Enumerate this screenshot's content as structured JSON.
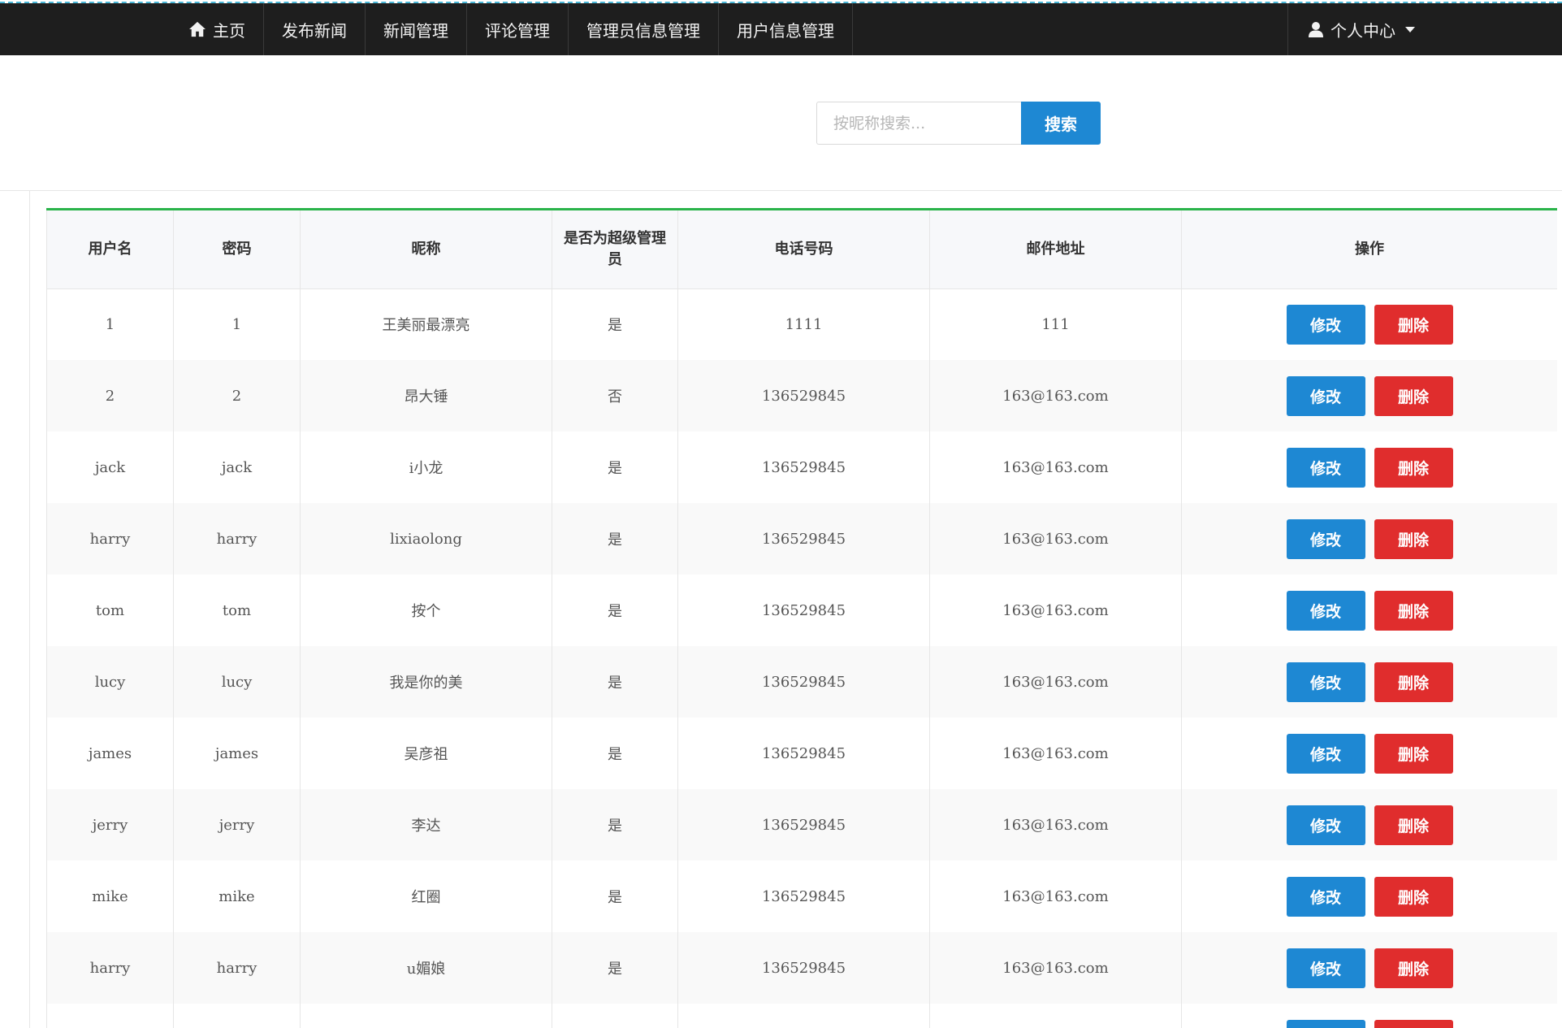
{
  "nav": {
    "items": [
      {
        "label": "主页",
        "icon": "home-icon"
      },
      {
        "label": "发布新闻"
      },
      {
        "label": "新闻管理"
      },
      {
        "label": "评论管理"
      },
      {
        "label": "管理员信息管理"
      },
      {
        "label": "用户信息管理"
      }
    ],
    "user_menu": {
      "label": "个人中心",
      "icon": "user-icon"
    }
  },
  "search": {
    "placeholder": "按昵称搜索...",
    "button_label": "搜索"
  },
  "table": {
    "headers": [
      "用户名",
      "密码",
      "昵称",
      "是否为超级管理员",
      "电话号码",
      "邮件地址",
      "操作"
    ],
    "edit_label": "修改",
    "delete_label": "删除",
    "rows": [
      {
        "username": "1",
        "password": "1",
        "nickname": "王美丽最漂亮",
        "is_super": "是",
        "phone": "1111",
        "email": "111"
      },
      {
        "username": "2",
        "password": "2",
        "nickname": "昂大锤",
        "is_super": "否",
        "phone": "136529845",
        "email": "163@163.com"
      },
      {
        "username": "jack",
        "password": "jack",
        "nickname": "i小龙",
        "is_super": "是",
        "phone": "136529845",
        "email": "163@163.com"
      },
      {
        "username": "harry",
        "password": "harry",
        "nickname": "lixiaolong",
        "is_super": "是",
        "phone": "136529845",
        "email": "163@163.com"
      },
      {
        "username": "tom",
        "password": "tom",
        "nickname": "按个",
        "is_super": "是",
        "phone": "136529845",
        "email": "163@163.com"
      },
      {
        "username": "lucy",
        "password": "lucy",
        "nickname": "我是你的美",
        "is_super": "是",
        "phone": "136529845",
        "email": "163@163.com"
      },
      {
        "username": "james",
        "password": "james",
        "nickname": "吴彦祖",
        "is_super": "是",
        "phone": "136529845",
        "email": "163@163.com"
      },
      {
        "username": "jerry",
        "password": "jerry",
        "nickname": "李达",
        "is_super": "是",
        "phone": "136529845",
        "email": "163@163.com"
      },
      {
        "username": "mike",
        "password": "mike",
        "nickname": "红圈",
        "is_super": "是",
        "phone": "136529845",
        "email": "163@163.com"
      },
      {
        "username": "harry",
        "password": "harry",
        "nickname": "u媚娘",
        "is_super": "是",
        "phone": "136529845",
        "email": "163@163.com"
      },
      {
        "username": "",
        "password": "",
        "nickname": "",
        "is_super": "",
        "phone": "",
        "email": ""
      }
    ]
  },
  "colors": {
    "navbar": "#1e1e1e",
    "primary": "#1e88d3",
    "danger": "#e02d2d",
    "accent_border": "#2ab34a"
  }
}
